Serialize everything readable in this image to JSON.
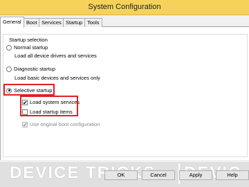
{
  "window": {
    "title": "System Configuration"
  },
  "tabs": [
    {
      "label": "General"
    },
    {
      "label": "Boot"
    },
    {
      "label": "Services"
    },
    {
      "label": "Startup"
    },
    {
      "label": "Tools"
    }
  ],
  "startup_selection": {
    "group_label": "Startup selection",
    "normal": {
      "label": "Normal startup",
      "desc": "Load all device drivers and services"
    },
    "diagnostic": {
      "label": "Diagnostic startup",
      "desc": "Load basic devices and services only"
    },
    "selective": {
      "label": "Selective startup",
      "selected": true
    },
    "load_system_services": {
      "label": "Load system services",
      "checked": true
    },
    "load_startup_items": {
      "label": "Load startup items",
      "checked": false
    },
    "use_original_boot_config": {
      "label": "Use original boot configuration",
      "checked": true,
      "disabled": true
    }
  },
  "watermark": {
    "text_left": "DEVICE TRICKS",
    "text_right": "DEVIC"
  },
  "buttons": {
    "ok": "OK",
    "cancel": "Cancel",
    "apply": "Apply",
    "help": "Help"
  },
  "colors": {
    "titlebar": "#f7d25a",
    "highlight_box": "#e02020"
  }
}
